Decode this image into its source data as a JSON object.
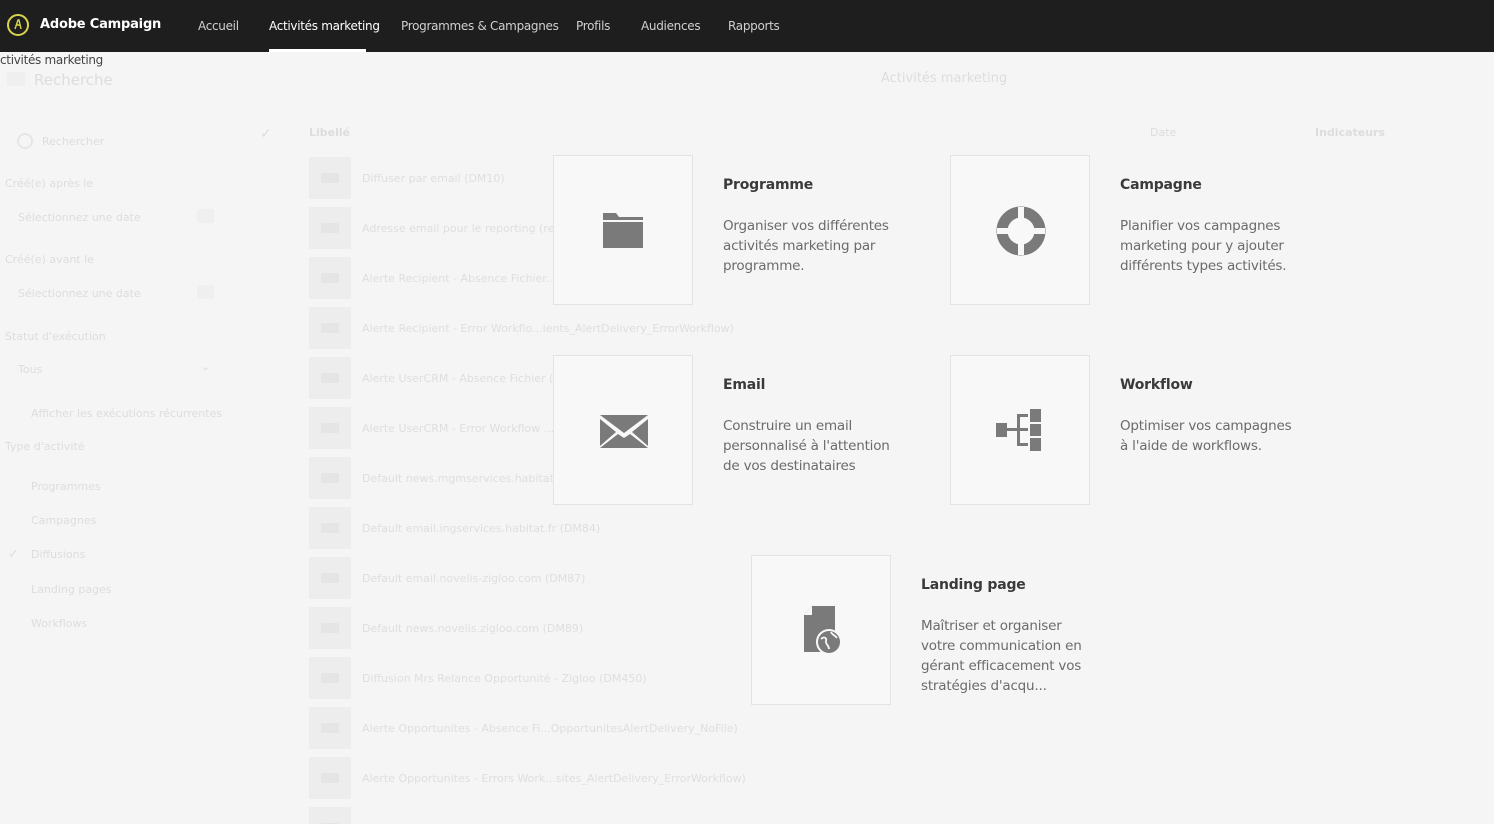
{
  "app": {
    "brand": "Adobe Campaign"
  },
  "nav": [
    {
      "label": "Accueil",
      "active": false
    },
    {
      "label": "Activités marketing",
      "active": true
    },
    {
      "label": "Programmes & Campagnes",
      "active": false
    },
    {
      "label": "Profils",
      "active": false
    },
    {
      "label": "Audiences",
      "active": false
    },
    {
      "label": "Rapports",
      "active": false
    }
  ],
  "breadcrumb": "ctivités marketing",
  "background": {
    "search_title": "Recherche",
    "view_dropdown": "Activités marketing",
    "search_placeholder": "Rechercher",
    "created_after_label": "Créé(e) après le",
    "created_before_label": "Créé(e) avant le",
    "date_placeholder": "Sélectionnez une date",
    "status_label": "Statut d'exécution",
    "status_value": "Tous",
    "show_recent": "Afficher les exécutions récurrentes",
    "type_label": "Type d'activité",
    "types": [
      "Programmes",
      "Campagnes",
      "Diffusions",
      "Landing pages",
      "Workflows"
    ],
    "table_headers": {
      "label": "Libellé",
      "date": "Date",
      "indicators": "Indicateurs"
    },
    "rows": [
      "Diffuser par email (DM10)",
      "Adresse email pour le reporting (rep",
      "Alerte Recipient - Absence Fichier...in",
      "Alerte Recipient - Error Workflo...ients_AlertDelivery_ErrorWorkflow)",
      "Alerte UserCRM - Absence Fichier (A",
      "Alerte UserCRM - Error Workflow ...",
      "Default news.mgmservices.habitat.fr",
      "Default email.ingservices.habitat.fr (DM84)",
      "Default email.novelis-zigloo.com (DM87)",
      "Default news.novelis.zigloo.com (DM89)",
      "Diffusion Mrs Relance Opportunité - Zigloo (DM450)",
      "Alerte Opportunites - Absence Fi...OpportunitesAlertDelivery_NoFile)",
      "Alerte Opportunites - Errors Work...sites_AlertDelivery_ErrorWorkflow)"
    ]
  },
  "cards": [
    {
      "title": "Programme",
      "description": "Organiser vos différentes activités marketing par programme.",
      "icon": "folder-icon"
    },
    {
      "title": "Campagne",
      "description": "Planifier vos campagnes marketing pour y ajouter différents types activités.",
      "icon": "lifebuoy-icon"
    },
    {
      "title": "Email",
      "description": "Construire un email personnalisé à l'attention de vos destinataires",
      "icon": "envelope-icon"
    },
    {
      "title": "Workflow",
      "description": "Optimiser vos campagnes à l'aide de workflows.",
      "icon": "workflow-icon"
    },
    {
      "title": "Landing page",
      "description": "Maîtriser et organiser votre communication en gérant efficacement vos stratégies d'acqu...",
      "icon": "landing-page-icon"
    }
  ],
  "colors": {
    "topbar": "#1e1e1e",
    "logo_ring": "#d9d34c",
    "icon_gray": "#7a7a7a"
  }
}
